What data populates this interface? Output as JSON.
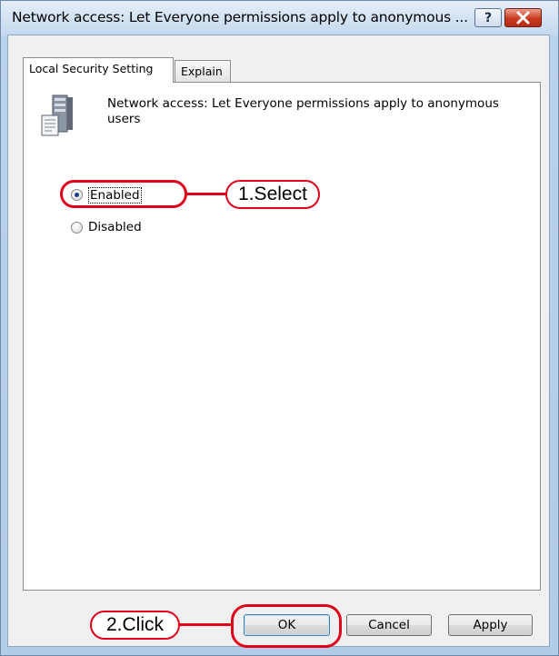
{
  "window": {
    "title": "Network access: Let Everyone permissions apply to anonymous ...",
    "help_glyph": "?",
    "close_icon": "close-icon"
  },
  "tabs": [
    {
      "label": "Local Security Setting",
      "active": true
    },
    {
      "label": "Explain",
      "active": false
    }
  ],
  "policy": {
    "icon": "server-policy-icon",
    "description": "Network access: Let Everyone permissions apply to anonymous users"
  },
  "options": [
    {
      "label": "Enabled",
      "selected": true
    },
    {
      "label": "Disabled",
      "selected": false
    }
  ],
  "buttons": {
    "ok": "OK",
    "cancel": "Cancel",
    "apply": "Apply"
  },
  "callouts": {
    "select": "1.Select",
    "click": "2.Click"
  },
  "colors": {
    "callout": "#e1001a",
    "titlebar": "#c4d8ee",
    "close_button": "#c83a20"
  }
}
